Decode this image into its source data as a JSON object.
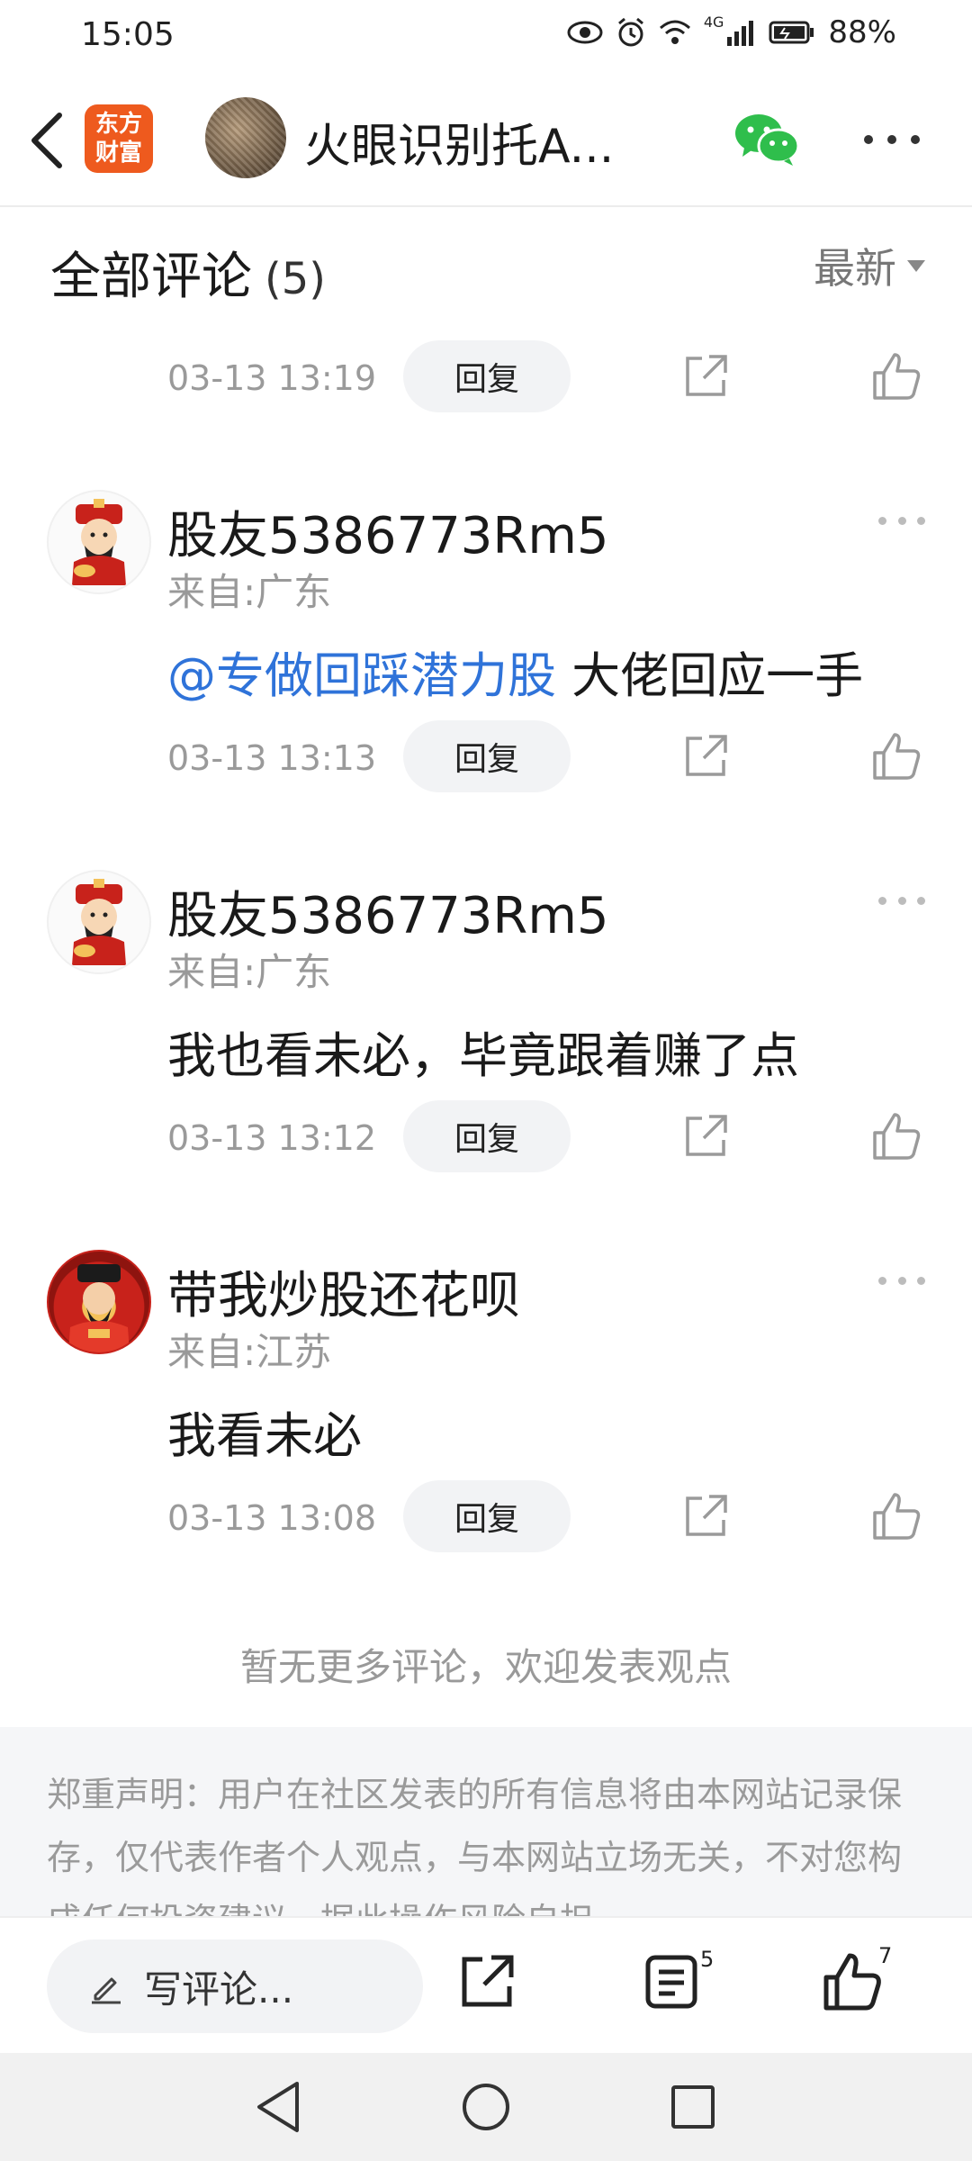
{
  "status_bar": {
    "time": "15:05",
    "network": "4G",
    "battery": "88%",
    "icons": [
      "eye-icon",
      "alarm-icon",
      "wifi-icon",
      "signal-icon",
      "battery-icon"
    ]
  },
  "header": {
    "app_logo": "东方财富",
    "title": "火眼识别托A...",
    "icons": [
      "back-arrow-icon",
      "wechat-icon",
      "more-icon"
    ]
  },
  "comments": {
    "title": "全部评论",
    "count": "(5)",
    "sort_label": "最新",
    "reply_label": "回复",
    "items": [
      {
        "time": "03-13 13:19"
      },
      {
        "user": "股友5386773Rm5",
        "location": "来自:广东",
        "mention": "@专做回踩潜力股",
        "text": " 大佬回应一手",
        "time": "03-13 13:13"
      },
      {
        "user": "股友5386773Rm5",
        "location": "来自:广东",
        "text": "我也看未必，毕竟跟着赚了点",
        "time": "03-13 13:12"
      },
      {
        "user": "带我炒股还花呗",
        "location": "来自:江苏",
        "text": "我看未必",
        "time": "03-13 13:08"
      }
    ],
    "no_more": "暂无更多评论，欢迎发表观点"
  },
  "disclaimer": {
    "text": "郑重声明：用户在社区发表的所有信息将由本网站记录保存，仅代表作者个人观点，与本网站立场无关，不对您构成任何投资建议，据此操作风险自担。"
  },
  "action_bar": {
    "write_placeholder": "写评论...",
    "comment_count": "5",
    "like_count": "7"
  },
  "colors": {
    "brand": "#ee5a1e",
    "mention": "#2f73d9",
    "wechat": "#2fbe4c"
  }
}
